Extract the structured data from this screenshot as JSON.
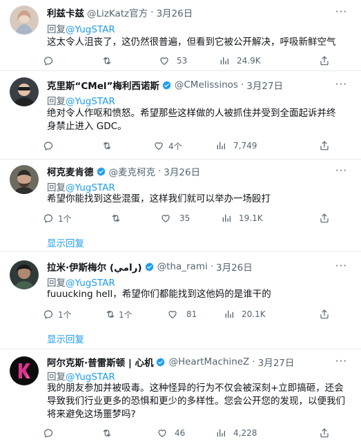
{
  "tweets": [
    {
      "name": "利兹卡兹",
      "handle": "@LizKatz官方",
      "dot": "·",
      "date": "3月26日",
      "reply_prefix": "回复",
      "reply_mention": "@YugSTAR",
      "text": "这太令人沮丧了，这仍然很普遍，但看到它被公开解决，呼吸新鲜空气",
      "replies": "",
      "retweets": "",
      "likes": "53",
      "views": "24.9K"
    },
    {
      "name": "克里斯“CMel”梅利西诺斯",
      "handle": "@CMelissinos",
      "dot": "·",
      "date": "3月27日",
      "reply_prefix": "回复",
      "reply_mention": "@YugSTAR",
      "text": "绝对令人作呕和愤怒。希望那些这样做的人被抓住并受到全面起诉并终身禁止进入 GDC。",
      "replies": "",
      "retweets": "",
      "likes": "4个",
      "views": "7,749"
    },
    {
      "name": "柯克麦肯德",
      "handle": "@麦克柯克",
      "dot": "·",
      "date": "3月26日",
      "reply_prefix": "回复",
      "reply_mention": "@YugSTAR",
      "text": "希望你能找到这些混蛋，这样我们就可以举办一场殴打",
      "replies": "1个",
      "retweets": "",
      "likes": "35",
      "views": "19.1K",
      "show_replies": "显示回复"
    },
    {
      "name": "拉米·伊斯梅尔 (رامي)",
      "handle": "@tha_rami",
      "dot": "·",
      "date": "3月26日",
      "reply_prefix": "回复",
      "reply_mention": "@YugSTAR",
      "text": "fuuucking hell，希望你们都能找到这他妈的是谁干的",
      "replies": "1个",
      "retweets": "1个",
      "likes": "81",
      "views": "20.1K",
      "show_replies": "显示回复"
    },
    {
      "name": "阿尔克斯·普雷斯顿 | 心机",
      "handle": "@HeartMachineZ",
      "dot": "·",
      "date": "3月27日",
      "reply_prefix": "回复",
      "reply_mention": "@YugSTAR",
      "text": "我的朋友参加并被吸毒。这种怪异的行为不仅会被深刻+立即搞砸，还会导致我们行业更多的恐惧和更少的多样性。您会公开您的发现，以便我们将来避免这场噩梦吗?",
      "replies": "",
      "retweets": "",
      "likes": "46",
      "views": "4,228"
    }
  ],
  "more_icon": "···",
  "colors": {
    "link": "#1d9bf0",
    "muted": "#536471",
    "verified": "#1d9bf0",
    "divider": "#e6ecf0"
  },
  "icons": [
    "reply-icon",
    "retweet-icon",
    "like-icon",
    "views-icon",
    "share-icon",
    "verified-badge-icon",
    "more-icon"
  ]
}
